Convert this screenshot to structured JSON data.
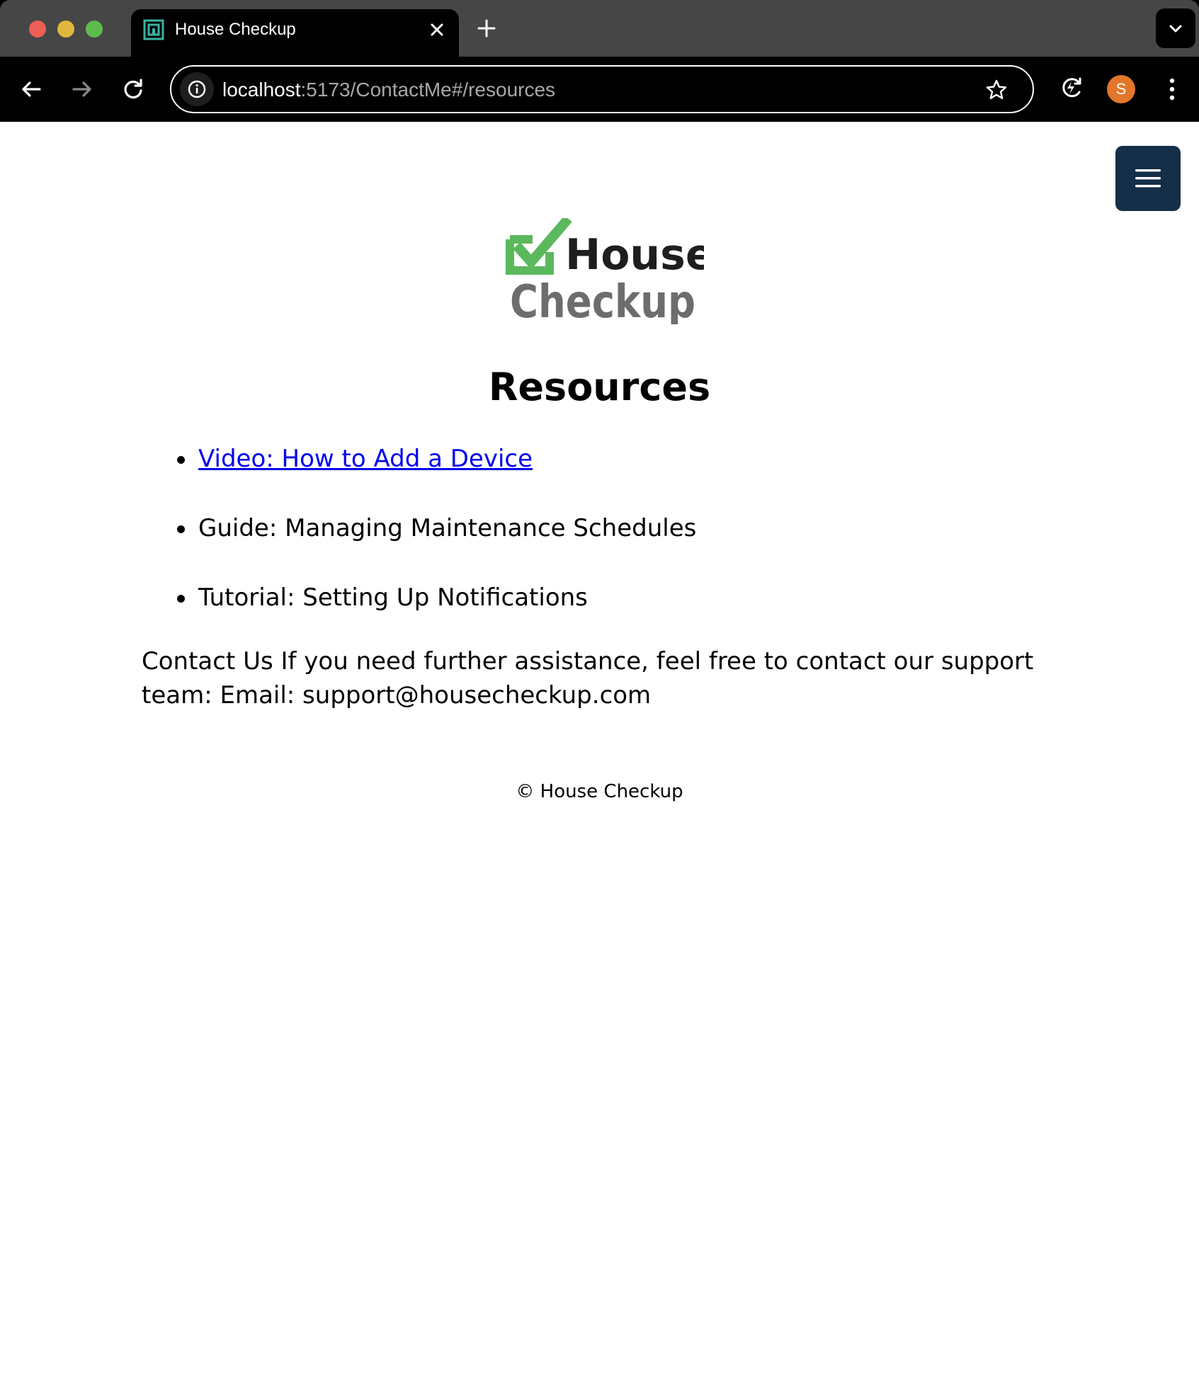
{
  "browser": {
    "tab": {
      "title": "House Checkup",
      "favicon": "house-checkup-favicon",
      "close_icon": "close-icon"
    },
    "new_tab_icon": "plus-icon",
    "tab_dropdown_icon": "chevron-down-icon",
    "url_host": "localhost",
    "url_rest": ":5173/ContactMe#/resources",
    "avatar_letter": "S",
    "colors": {
      "tabbar": "#464646",
      "toolbar": "#000000",
      "avatar": "#e2762a",
      "close": "#ed5f57",
      "minimize": "#e0b83b",
      "maximize": "#5dbb4b"
    }
  },
  "page": {
    "menu_button_icon": "hamburger-menu-icon",
    "menu_button_color": "#142f47",
    "logo": {
      "line1": "House",
      "line2": "Checkup",
      "check_color": "#5cb85c",
      "line1_color": "#1e1e1e",
      "line2_color": "#6d6d6d"
    },
    "heading": "Resources",
    "resources": [
      {
        "label": "Video: How to Add a Device",
        "is_link": true
      },
      {
        "label": "Guide: Managing Maintenance Schedules",
        "is_link": false
      },
      {
        "label": "Tutorial: Setting Up Notifications",
        "is_link": false
      }
    ],
    "contact_text": "Contact Us If you need further assistance, feel free to contact our support team: Email: support@housecheckup.com",
    "footer": "© House Checkup",
    "link_color": "#0000ee"
  }
}
